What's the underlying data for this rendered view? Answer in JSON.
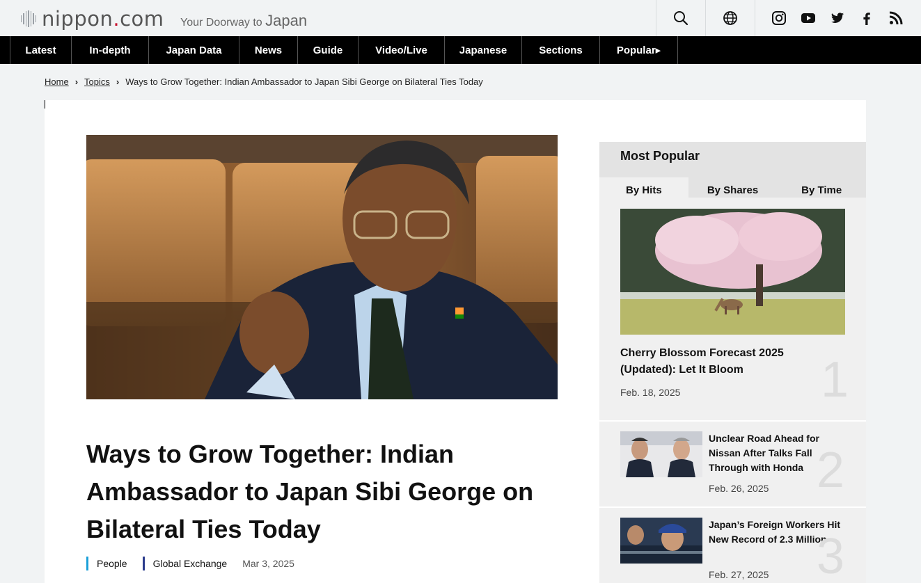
{
  "header": {
    "logo_text_main": "nippon",
    "logo_text_dot": ".",
    "logo_text_tld": "com",
    "tagline_small": "Your Doorway to ",
    "tagline_big": "Japan"
  },
  "nav": {
    "items": [
      {
        "label": "Latest"
      },
      {
        "label": "In-depth"
      },
      {
        "label": "Japan Data"
      },
      {
        "label": "News"
      },
      {
        "label": "Guide"
      },
      {
        "label": "Video/Live"
      },
      {
        "label": "Japanese"
      },
      {
        "label": "Sections"
      },
      {
        "label": "Popular▸"
      }
    ]
  },
  "breadcrumb": {
    "home": "Home",
    "topics": "Topics",
    "current": "Ways to Grow Together: Indian Ambassador to Japan Sibi George on Bilateral Ties Today"
  },
  "article": {
    "title": "Ways to Grow Together: Indian Ambassador to Japan Sibi George on Bilateral Ties Today",
    "categories": [
      {
        "label": "People",
        "color": "#1a9fd8"
      },
      {
        "label": "Global Exchange",
        "color": "#2a3a8c"
      }
    ],
    "date": "Mar 3, 2025"
  },
  "popular": {
    "title": "Most Popular",
    "tabs": [
      {
        "label": "By Hits",
        "active": true
      },
      {
        "label": "By Shares",
        "active": false
      },
      {
        "label": "By Time",
        "active": false
      }
    ],
    "items": [
      {
        "rank": "1",
        "title": "Cherry Blossom Forecast 2025 (Updated): Let It Bloom",
        "date": "Feb. 18, 2025"
      },
      {
        "rank": "2",
        "title": "Unclear Road Ahead for Nissan After Talks Fall Through with Honda",
        "date": "Feb. 26, 2025"
      },
      {
        "rank": "3",
        "title": "Japan’s Foreign Workers Hit New Record of 2.3 Million",
        "date": "Feb. 27, 2025"
      }
    ]
  },
  "colors": {
    "nav_bg": "#000000",
    "brand_red": "#c8102e"
  }
}
